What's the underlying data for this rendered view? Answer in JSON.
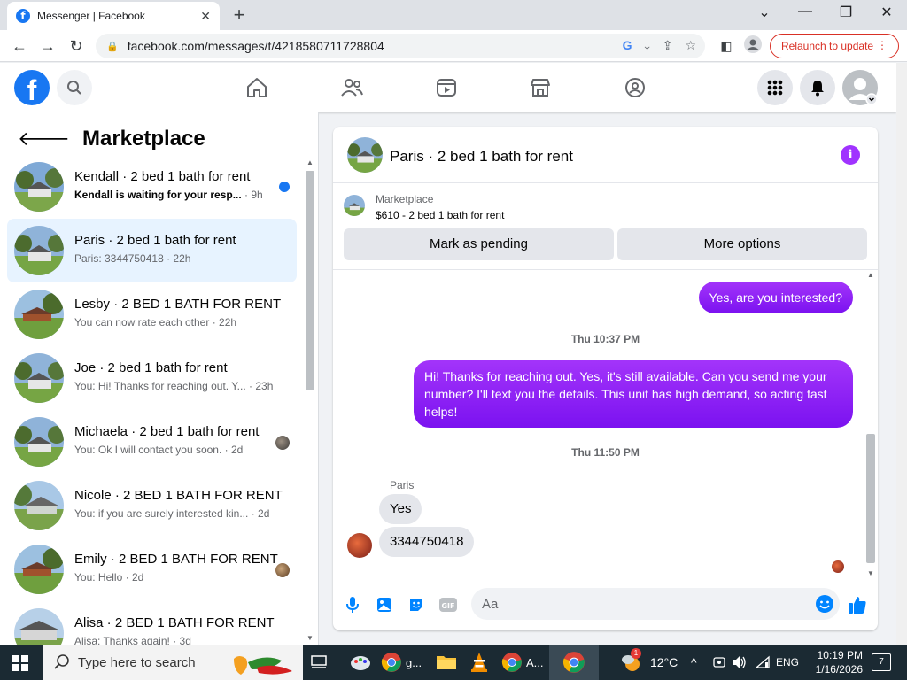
{
  "browser": {
    "tab_title": "Messenger | Facebook",
    "url": "facebook.com/messages/t/4218580711728804",
    "relaunch_label": "Relaunch to update"
  },
  "sidebar": {
    "title": "Marketplace",
    "conversations": [
      {
        "name": "Kendall · 2 bed 1 bath for rent",
        "preview": "Kendall is waiting for your resp...",
        "time": "· 9h",
        "unread": true
      },
      {
        "name": "Paris · 2 bed 1 bath for rent",
        "preview": "Paris: 3344750418",
        "time": "· 22h",
        "active": true
      },
      {
        "name": "Lesby · 2 BED 1 BATH FOR RENT",
        "preview": "You can now rate each other",
        "time": "· 22h"
      },
      {
        "name": "Joe · 2 bed 1 bath for rent",
        "preview": "You: Hi! Thanks for reaching out. Y...",
        "time": "· 23h"
      },
      {
        "name": "Michaela · 2 bed 1 bath for rent",
        "preview": "You: Ok I will contact you soon.",
        "time": "· 2d"
      },
      {
        "name": "Nicole · 2 BED 1 BATH FOR RENT",
        "preview": "You: if you are surely interested kin...",
        "time": "· 2d"
      },
      {
        "name": "Emily · 2 BED 1 BATH FOR RENT",
        "preview": "You: Hello",
        "time": "· 2d"
      },
      {
        "name": "Alisa · 2 BED 1 BATH FOR RENT",
        "preview": "Alisa: Thanks again!",
        "time": "· 3d"
      }
    ]
  },
  "chat": {
    "title": "Paris · 2 bed 1 bath for rent",
    "listing_label": "Marketplace",
    "listing_price": "$610 - 2 bed 1 bath for rent",
    "mark_pending": "Mark as pending",
    "more_options": "More options",
    "messages": {
      "out1": "Yes, are you interested?",
      "ts1": "Thu 10:37 PM",
      "out2": "Hi!  Thanks for reaching out.  Yes, it's still available.  Can you send me your number? I'll  text you the details.  This unit has high demand, so acting fast helps!",
      "ts2": "Thu 11:50 PM",
      "sender": "Paris",
      "in1": "Yes",
      "in2": "3344750418"
    },
    "composer_placeholder": "Aa"
  },
  "taskbar": {
    "search_placeholder": "Type here to search",
    "app1_label": "g...",
    "app2_label": "A...",
    "weather": "12°C",
    "lang": "ENG",
    "time": "10:19 PM",
    "date": "1/16/2026",
    "notifications": "7",
    "chrome_badge": "1"
  }
}
